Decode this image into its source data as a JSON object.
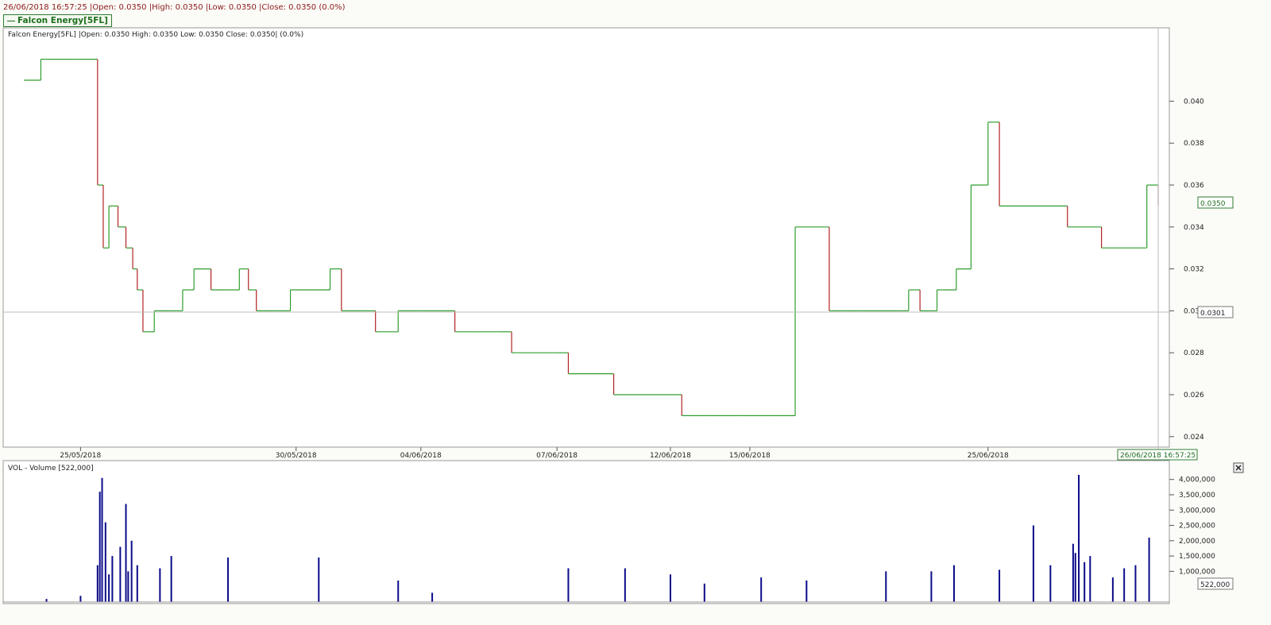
{
  "header": {
    "info_line": "26/06/2018 16:57:25 |Open: 0.0350 |High: 0.0350 |Low: 0.0350 |Close: 0.0350 (0.0%)",
    "tab_label": "Falcon Energy[5FL]"
  },
  "price_panel": {
    "legend": "Falcon Energy[5FL] |Open: 0.0350  High: 0.0350  Low: 0.0350  Close: 0.0350| (0.0%)",
    "last_price_label": "0.0350",
    "cursor_price_label": "0.0301",
    "cursor_time_label": "26/06/2018 16:57:25"
  },
  "volume_panel": {
    "legend": "VOL - Volume [522,000]",
    "last_volume_label": "522,000",
    "close_icon": "close-icon"
  },
  "colors": {
    "up": "#2e9e2e",
    "down": "#b22222",
    "volume": "#0b0b8a",
    "grid": "#c8c8c8"
  },
  "chart_data": [
    {
      "type": "line",
      "title": "Falcon Energy[5FL]",
      "y_axis_side": "right",
      "ylim": [
        0.0235,
        0.0435
      ],
      "yticks": [
        "0.024",
        "0.026",
        "0.028",
        "0.030",
        "0.032",
        "0.034",
        "0.036",
        "0.038",
        "0.040"
      ],
      "xticks": [
        "25/05/2018",
        "30/05/2018",
        "04/06/2018",
        "07/06/2018",
        "12/06/2018",
        "15/06/2018",
        "25/06/2018"
      ],
      "series": [
        {
          "style": "step",
          "t": [
            0.0,
            0.015,
            0.02,
            0.045,
            0.065,
            0.07,
            0.075,
            0.083,
            0.09,
            0.096,
            0.1,
            0.105,
            0.11,
            0.115,
            0.13,
            0.14,
            0.15,
            0.165,
            0.178,
            0.19,
            0.198,
            0.205,
            0.22,
            0.235,
            0.25,
            0.27,
            0.28,
            0.3,
            0.31,
            0.33,
            0.35,
            0.38,
            0.4,
            0.42,
            0.43,
            0.45,
            0.47,
            0.48,
            0.5,
            0.52,
            0.55,
            0.58,
            0.6,
            0.63,
            0.66,
            0.68,
            0.71,
            0.725,
            0.74,
            0.77,
            0.78,
            0.79,
            0.8,
            0.805,
            0.81,
            0.822,
            0.835,
            0.85,
            0.86,
            0.88,
            0.9,
            0.92,
            0.95,
            0.99,
            1.0
          ],
          "y": [
            0.041,
            0.042,
            0.042,
            0.042,
            0.036,
            0.033,
            0.035,
            0.034,
            0.033,
            0.032,
            0.031,
            0.029,
            0.029,
            0.03,
            0.03,
            0.031,
            0.032,
            0.031,
            0.031,
            0.032,
            0.031,
            0.03,
            0.03,
            0.031,
            0.031,
            0.032,
            0.03,
            0.03,
            0.029,
            0.03,
            0.03,
            0.029,
            0.029,
            0.029,
            0.028,
            0.028,
            0.028,
            0.027,
            0.027,
            0.026,
            0.026,
            0.025,
            0.025,
            0.025,
            0.025,
            0.034,
            0.03,
            0.03,
            0.03,
            0.03,
            0.031,
            0.03,
            0.03,
            0.031,
            0.031,
            0.032,
            0.036,
            0.039,
            0.035,
            0.035,
            0.035,
            0.034,
            0.033,
            0.036,
            0.035
          ]
        }
      ],
      "last": 0.035
    },
    {
      "type": "bar",
      "title": "VOL - Volume",
      "ylim": [
        0,
        4200000
      ],
      "yticks": [
        "1,000,000",
        "1,500,000",
        "2,000,000",
        "2,500,000",
        "3,000,000",
        "3,500,000",
        "4,000,000"
      ],
      "x": [
        0.02,
        0.05,
        0.065,
        0.067,
        0.069,
        0.072,
        0.075,
        0.078,
        0.085,
        0.09,
        0.092,
        0.095,
        0.1,
        0.12,
        0.13,
        0.18,
        0.26,
        0.33,
        0.36,
        0.48,
        0.53,
        0.57,
        0.6,
        0.65,
        0.69,
        0.76,
        0.8,
        0.82,
        0.86,
        0.89,
        0.905,
        0.925,
        0.927,
        0.93,
        0.935,
        0.94,
        0.96,
        0.97,
        0.98,
        0.992
      ],
      "values": [
        100000,
        200000,
        1200000,
        3600000,
        4050000,
        2600000,
        900000,
        1500000,
        1800000,
        3200000,
        1000000,
        2000000,
        1200000,
        1100000,
        1500000,
        1450000,
        1450000,
        700000,
        300000,
        1100000,
        1100000,
        900000,
        600000,
        800000,
        700000,
        1000000,
        1000000,
        1200000,
        1050000,
        2500000,
        1200000,
        1900000,
        1600000,
        4150000,
        1300000,
        1500000,
        800000,
        1100000,
        1200000,
        2100000
      ],
      "last": 522000
    }
  ]
}
